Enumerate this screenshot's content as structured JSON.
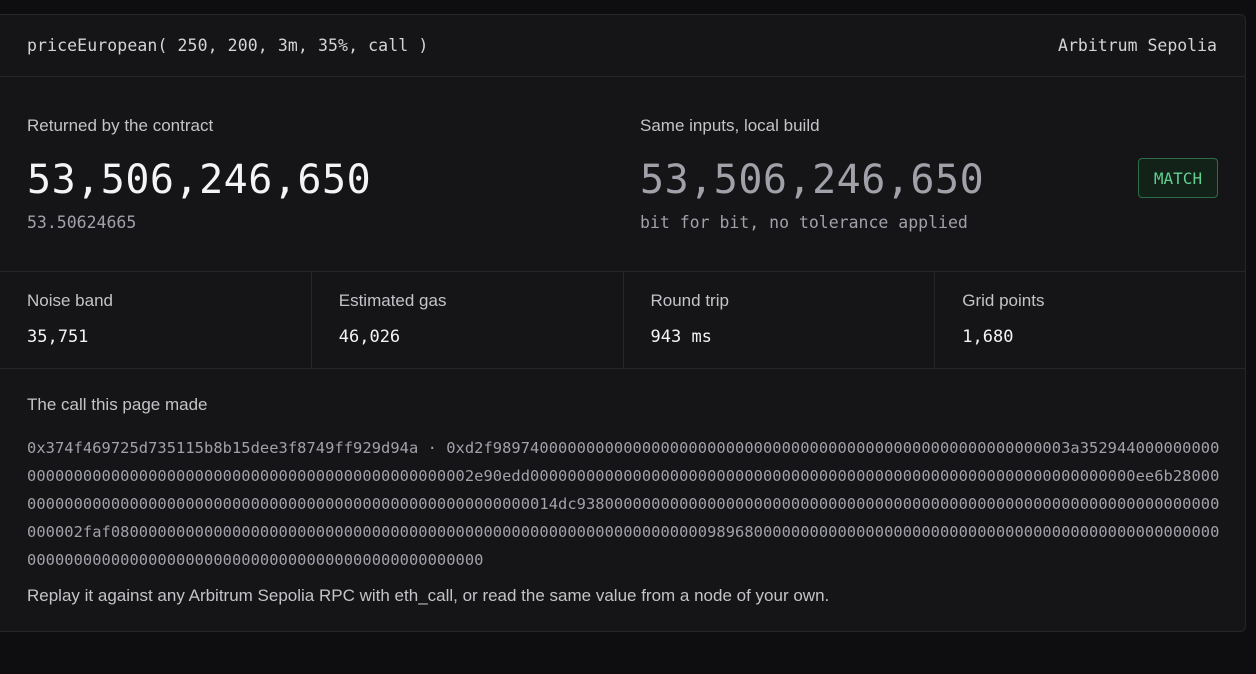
{
  "header": {
    "call_signature": "priceEuropean( 250, 200, 3m, 35%, call )",
    "network": "Arbitrum Sepolia"
  },
  "results": {
    "contract": {
      "label": "Returned by the contract",
      "value": "53,506,246,650",
      "decimal": "53.50624665"
    },
    "local": {
      "label": "Same inputs, local build",
      "value": "53,506,246,650",
      "note": "bit for bit, no tolerance applied"
    },
    "match_badge": "MATCH",
    "colors": {
      "match_text": "#5fd08f",
      "match_border": "#2f6d4a"
    }
  },
  "stats": [
    {
      "label": "Noise band",
      "value": "35,751"
    },
    {
      "label": "Estimated gas",
      "value": "46,026"
    },
    {
      "label": "Round trip",
      "value": "943 ms"
    },
    {
      "label": "Grid points",
      "value": "1,680"
    }
  ],
  "call": {
    "title": "The call this page made",
    "calldata": "0x374f469725d735115b8b15dee3f8749ff929d94a · 0xd2f98974000000000000000000000000000000000000000000000000000000003a352944000000000000000000000000000000000000000000000000000000002e90edd00000000000000000000000000000000000000000000000000000000000000000ee6b28000000000000000000000000000000000000000000000000000000000014dc938000000000000000000000000000000000000000000000000000000000000000000000002faf080000000000000000000000000000000000000000000000000000000000000098968000000000000000000000000000000000000000000000000000000000000000000000000000000000000000000000000000",
    "replay_note": "Replay it against any Arbitrum Sepolia RPC with eth_call, or read the same value from a node of your own."
  }
}
